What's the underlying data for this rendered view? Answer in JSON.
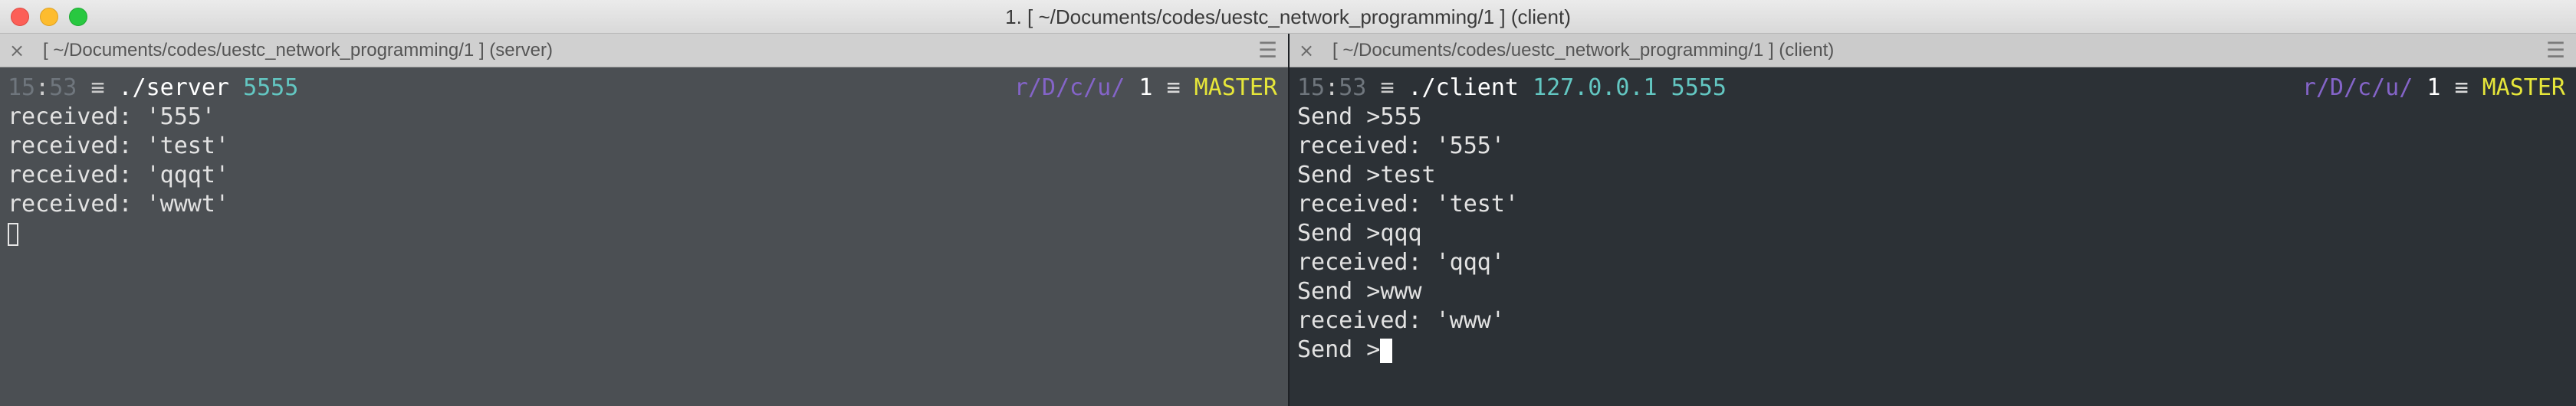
{
  "window": {
    "title": "1. [ ~/Documents/codes/uestc_network_programming/1 ] (client)"
  },
  "panes": {
    "server": {
      "tab_title": "[ ~/Documents/codes/uestc_network_programming/1 ] (server)",
      "prompt": {
        "hour": "15",
        "sep": ":",
        "minute": "53",
        "menu": "≡",
        "command": "./server",
        "args": "5555",
        "path": "r/D/c/u/",
        "job_count": "1",
        "eq": "≡",
        "branch": "MASTER"
      },
      "lines": [
        "received: '555'",
        "received: 'test'",
        "received: 'qqqt'",
        "received: 'wwwt'"
      ]
    },
    "client": {
      "tab_title": "[ ~/Documents/codes/uestc_network_programming/1 ] (client)",
      "prompt": {
        "hour": "15",
        "sep": ":",
        "minute": "53",
        "menu": "≡",
        "command": "./client",
        "args": "127.0.0.1 5555",
        "path": "r/D/c/u/",
        "job_count": "1",
        "eq": "≡",
        "branch": "MASTER"
      },
      "lines": [
        "Send >555",
        "received: '555'",
        "Send >test",
        "received: 'test'",
        "Send >qqq",
        "received: 'qqq'",
        "Send >www",
        "received: 'www'"
      ],
      "current_input": "Send >"
    }
  },
  "icons": {
    "close": "×",
    "menu": "☰"
  }
}
